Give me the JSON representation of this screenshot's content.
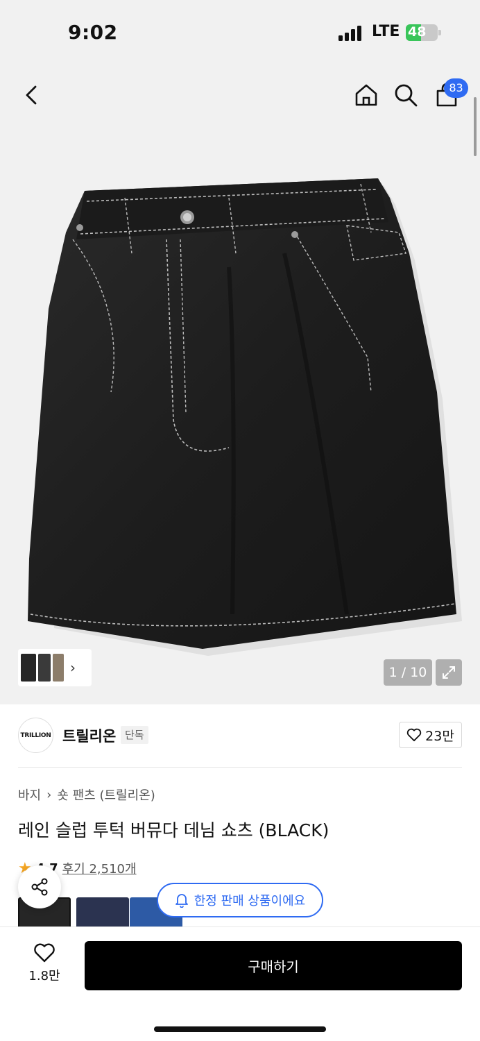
{
  "status_bar": {
    "time": "9:02",
    "network": "LTE",
    "battery": "48"
  },
  "header": {
    "cart_count": "83"
  },
  "gallery": {
    "counter": "1 / 10"
  },
  "brand": {
    "logo_text": "TRILLION",
    "name": "트릴리온",
    "tag": "단독",
    "likes": "23만"
  },
  "breadcrumb": {
    "category": "바지",
    "subcategory": "숏 팬츠 (트릴리온)"
  },
  "product": {
    "title": "레인 슬럽 투턱 버뮤다 데님 쇼츠 (BLACK)"
  },
  "rating": {
    "value": "4.7",
    "reviews": "후기 2,510개"
  },
  "notice": {
    "text": "한정 판매 상품이에요"
  },
  "bottom": {
    "wish_count": "1.8만",
    "buy_label": "구매하기"
  },
  "colors": {
    "accent": "#2f6bf2",
    "star": "#f5a623"
  }
}
